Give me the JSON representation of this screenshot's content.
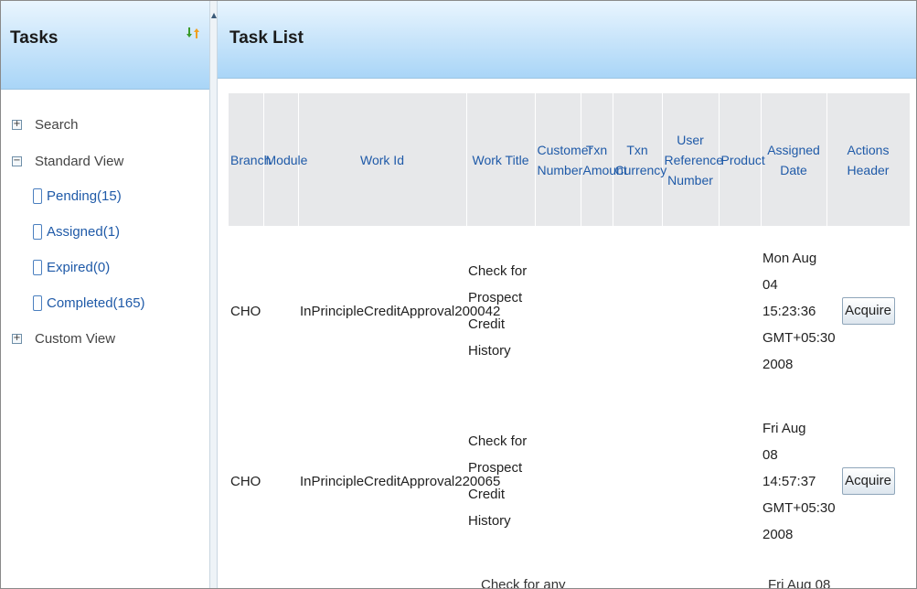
{
  "tasks_panel": {
    "title": "Tasks",
    "tree": [
      {
        "label": "Search",
        "expander": "+"
      },
      {
        "label": "Standard View",
        "expander": "−"
      },
      {
        "label": "Custom View",
        "expander": "+"
      }
    ],
    "standard_view_items": [
      {
        "label": "Pending(15)"
      },
      {
        "label": "Assigned(1)"
      },
      {
        "label": "Expired(0)"
      },
      {
        "label": "Completed(165)"
      }
    ]
  },
  "task_list": {
    "title": "Task List",
    "columns": [
      "Branch",
      "Module",
      "Work Id",
      "Work Title",
      "Customer Number",
      "Txn Amount",
      "Txn Currency",
      "User Reference Number",
      "Product",
      "Assigned Date",
      "Actions Header"
    ],
    "rows": [
      {
        "branch": "CHO",
        "module": "",
        "work_id": "InPrincipleCreditApproval200042",
        "work_title": "Check for Prospect Credit History",
        "customer_number": "",
        "txn_amount": "",
        "txn_currency": "",
        "user_reference_number": "",
        "product": "",
        "assigned_date": "Mon Aug 04 15:23:36 GMT+05:30 2008",
        "action": "Acquire"
      },
      {
        "branch": "CHO",
        "module": "",
        "work_id": "InPrincipleCreditApproval220065",
        "work_title": "Check for Prospect Credit History",
        "customer_number": "",
        "txn_amount": "",
        "txn_currency": "",
        "user_reference_number": "",
        "product": "",
        "assigned_date": "Fri Aug 08 14:57:37 GMT+05:30 2008",
        "action": "Acquire"
      }
    ],
    "partial_row": {
      "work_title": "Check for any",
      "assigned_date": "Fri Aug 08"
    }
  },
  "icons": {
    "refresh": "refresh-icon",
    "collapse": "collapse-arrow-icon",
    "leaf": "document-icon",
    "expand": "plus-icon",
    "collapse_tree": "minus-icon"
  },
  "colors": {
    "header_gradient_top": "#e9f5fe",
    "header_gradient_bottom": "#a9d5f7",
    "link_blue": "#1f5aa8",
    "table_header_bg": "#e7e8ea"
  }
}
